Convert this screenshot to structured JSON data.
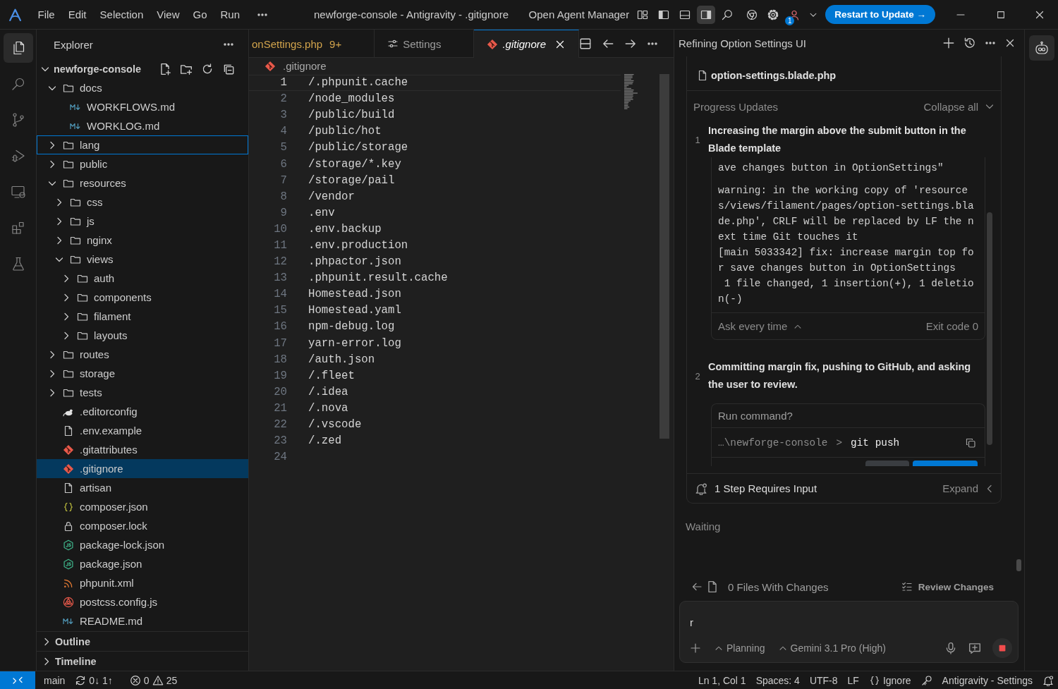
{
  "title_bar": {
    "menu": [
      "File",
      "Edit",
      "Selection",
      "View",
      "Go",
      "Run"
    ],
    "title": "newforge-console - Antigravity - .gitignore",
    "agent_manager": "Open Agent Manager",
    "layout_toggles": [
      {
        "kind": "primary-sidebar",
        "on": true,
        "selected": false
      },
      {
        "kind": "panel",
        "on": false,
        "selected": false
      },
      {
        "kind": "secondary-sidebar",
        "on": true,
        "selected": true
      }
    ],
    "account_badge": "1",
    "update_button": "Restart to Update →"
  },
  "activity_bar": [
    {
      "kind": "explorer",
      "selected": true
    },
    {
      "kind": "search",
      "selected": false
    },
    {
      "kind": "source-control",
      "selected": false
    },
    {
      "kind": "run-debug",
      "selected": false
    },
    {
      "kind": "remote",
      "selected": false
    },
    {
      "kind": "extensions",
      "selected": false
    },
    {
      "kind": "testing",
      "selected": false
    }
  ],
  "explorer": {
    "title": "Explorer",
    "root": {
      "label": "newforge-console",
      "kind": "workspace",
      "expanded": true,
      "selected": false,
      "focused": false,
      "children": [
        {
          "label": "docs",
          "kind": "folder",
          "expanded": true,
          "selected": false,
          "focused": false,
          "children": [
            {
              "label": "WORKFLOWS.md",
              "kind": "markdown",
              "selected": false,
              "focused": false
            },
            {
              "label": "WORKLOG.md",
              "kind": "markdown",
              "selected": false,
              "focused": false
            }
          ]
        },
        {
          "label": "lang",
          "kind": "folder",
          "expanded": false,
          "selected": false,
          "focused": true
        },
        {
          "label": "public",
          "kind": "folder",
          "expanded": false,
          "selected": false,
          "focused": false
        },
        {
          "label": "resources",
          "kind": "folder",
          "expanded": true,
          "selected": false,
          "focused": false,
          "children": [
            {
              "label": "css",
              "kind": "folder",
              "expanded": false,
              "selected": false,
              "focused": false
            },
            {
              "label": "js",
              "kind": "folder",
              "expanded": false,
              "selected": false,
              "focused": false
            },
            {
              "label": "nginx",
              "kind": "folder",
              "expanded": false,
              "selected": false,
              "focused": false
            },
            {
              "label": "views",
              "kind": "folder",
              "expanded": true,
              "selected": false,
              "focused": false,
              "children": [
                {
                  "label": "auth",
                  "kind": "folder",
                  "expanded": false,
                  "selected": false,
                  "focused": false
                },
                {
                  "label": "components",
                  "kind": "folder",
                  "expanded": false,
                  "selected": false,
                  "focused": false
                },
                {
                  "label": "filament",
                  "kind": "folder",
                  "expanded": false,
                  "selected": false,
                  "focused": false
                },
                {
                  "label": "layouts",
                  "kind": "folder",
                  "expanded": false,
                  "selected": false,
                  "focused": false
                }
              ]
            }
          ]
        },
        {
          "label": "routes",
          "kind": "folder",
          "expanded": false,
          "selected": false,
          "focused": false
        },
        {
          "label": "storage",
          "kind": "folder",
          "expanded": false,
          "selected": false,
          "focused": false
        },
        {
          "label": "tests",
          "kind": "folder",
          "expanded": false,
          "selected": false,
          "focused": false
        },
        {
          "label": ".editorconfig",
          "kind": "editorconfig",
          "selected": false,
          "focused": false
        },
        {
          "label": ".env.example",
          "kind": "text",
          "selected": false,
          "focused": false
        },
        {
          "label": ".gitattributes",
          "kind": "git",
          "selected": false,
          "focused": false
        },
        {
          "label": ".gitignore",
          "kind": "git",
          "selected": true,
          "focused": false
        },
        {
          "label": "artisan",
          "kind": "text",
          "selected": false,
          "focused": false
        },
        {
          "label": "composer.json",
          "kind": "json",
          "selected": false,
          "focused": false
        },
        {
          "label": "composer.lock",
          "kind": "lock",
          "selected": false,
          "focused": false
        },
        {
          "label": "package-lock.json",
          "kind": "npm",
          "selected": false,
          "focused": false
        },
        {
          "label": "package.json",
          "kind": "npm",
          "selected": false,
          "focused": false
        },
        {
          "label": "phpunit.xml",
          "kind": "xml",
          "selected": false,
          "focused": false
        },
        {
          "label": "postcss.config.js",
          "kind": "postcss",
          "selected": false,
          "focused": false
        },
        {
          "label": "README.md",
          "kind": "markdown",
          "selected": false,
          "focused": false
        }
      ]
    },
    "sections": [
      {
        "label": "Outline",
        "expanded": false
      },
      {
        "label": "Timeline",
        "expanded": false
      }
    ]
  },
  "editor": {
    "tabs": [
      {
        "label": "onSettings.php",
        "badge": "9+",
        "kind": "php",
        "selected": false,
        "preview": false
      },
      {
        "label": "Settings",
        "kind": "settings",
        "selected": false,
        "preview": false
      },
      {
        "label": ".gitignore",
        "kind": "git",
        "selected": true,
        "preview": true
      }
    ],
    "breadcrumb": {
      "label": ".gitignore",
      "kind": "git"
    },
    "lines": [
      {
        "number": "1",
        "text": "/.phpunit.cache",
        "current": true
      },
      {
        "number": "2",
        "text": "/node_modules",
        "current": false
      },
      {
        "number": "3",
        "text": "/public/build",
        "current": false
      },
      {
        "number": "4",
        "text": "/public/hot",
        "current": false
      },
      {
        "number": "5",
        "text": "/public/storage",
        "current": false
      },
      {
        "number": "6",
        "text": "/storage/*.key",
        "current": false
      },
      {
        "number": "7",
        "text": "/storage/pail",
        "current": false
      },
      {
        "number": "8",
        "text": "/vendor",
        "current": false
      },
      {
        "number": "9",
        "text": ".env",
        "current": false
      },
      {
        "number": "10",
        "text": ".env.backup",
        "current": false
      },
      {
        "number": "11",
        "text": ".env.production",
        "current": false
      },
      {
        "number": "12",
        "text": ".phpactor.json",
        "current": false
      },
      {
        "number": "13",
        "text": ".phpunit.result.cache",
        "current": false
      },
      {
        "number": "14",
        "text": "Homestead.json",
        "current": false
      },
      {
        "number": "15",
        "text": "Homestead.yaml",
        "current": false
      },
      {
        "number": "16",
        "text": "npm-debug.log",
        "current": false
      },
      {
        "number": "17",
        "text": "yarn-error.log",
        "current": false
      },
      {
        "number": "18",
        "text": "/auth.json",
        "current": false
      },
      {
        "number": "19",
        "text": "/.fleet",
        "current": false
      },
      {
        "number": "20",
        "text": "/.idea",
        "current": false
      },
      {
        "number": "21",
        "text": "/.nova",
        "current": false
      },
      {
        "number": "22",
        "text": "/.vscode",
        "current": false
      },
      {
        "number": "23",
        "text": "/.zed",
        "current": false
      },
      {
        "number": "24",
        "current": false
      }
    ]
  },
  "agent_panel": {
    "title": "Refining Option Settings UI",
    "edited_files": [
      "option-settings.blade.php"
    ],
    "progress_title": "Progress Updates",
    "collapse_label": "Collapse all",
    "steps": [
      {
        "number": "1",
        "title": "Increasing the margin above the submit button in the Blade template",
        "kind": "terminal",
        "output": [
          [
            "ave changes button in OptionSettings\""
          ],
          [
            "warning: in the working copy of 'resource",
            "s/views/filament/pages/option-settings.bla",
            "de.php', CRLF will be replaced by LF the n",
            "ext time Git touches it",
            "[main 5033342] fix: increase margin top fo",
            "r save changes button in OptionSettings",
            " 1 file changed, 1 insertion(+), 1 deletio",
            "n(-)"
          ]
        ],
        "approval": "Ask every time",
        "exit_status": "Exit code 0"
      },
      {
        "number": "2",
        "title": "Committing margin fix, pushing to GitHub, and asking the user to review.",
        "kind": "command",
        "prompt": "Run command?",
        "cwd": "…\\newforge-console",
        "separator": ">",
        "command": "git push"
      }
    ],
    "input_required": "1 Step Requires Input",
    "expand_label": "Expand",
    "status": "Waiting",
    "changes_label": "0 Files With Changes",
    "review_label": "Review Changes",
    "composer": {
      "value": "r",
      "mode": "Planning",
      "model": "Gemini 3.1 Pro (High)"
    }
  },
  "status_bar": {
    "branch": "main",
    "sync": "0↓ 1↑",
    "errors": "0",
    "warnings": "25",
    "position": "Ln 1, Col 1",
    "indent": "Spaces: 4",
    "encoding": "UTF-8",
    "eol": "LF",
    "language": "Ignore",
    "profile": "Antigravity - Settings"
  }
}
